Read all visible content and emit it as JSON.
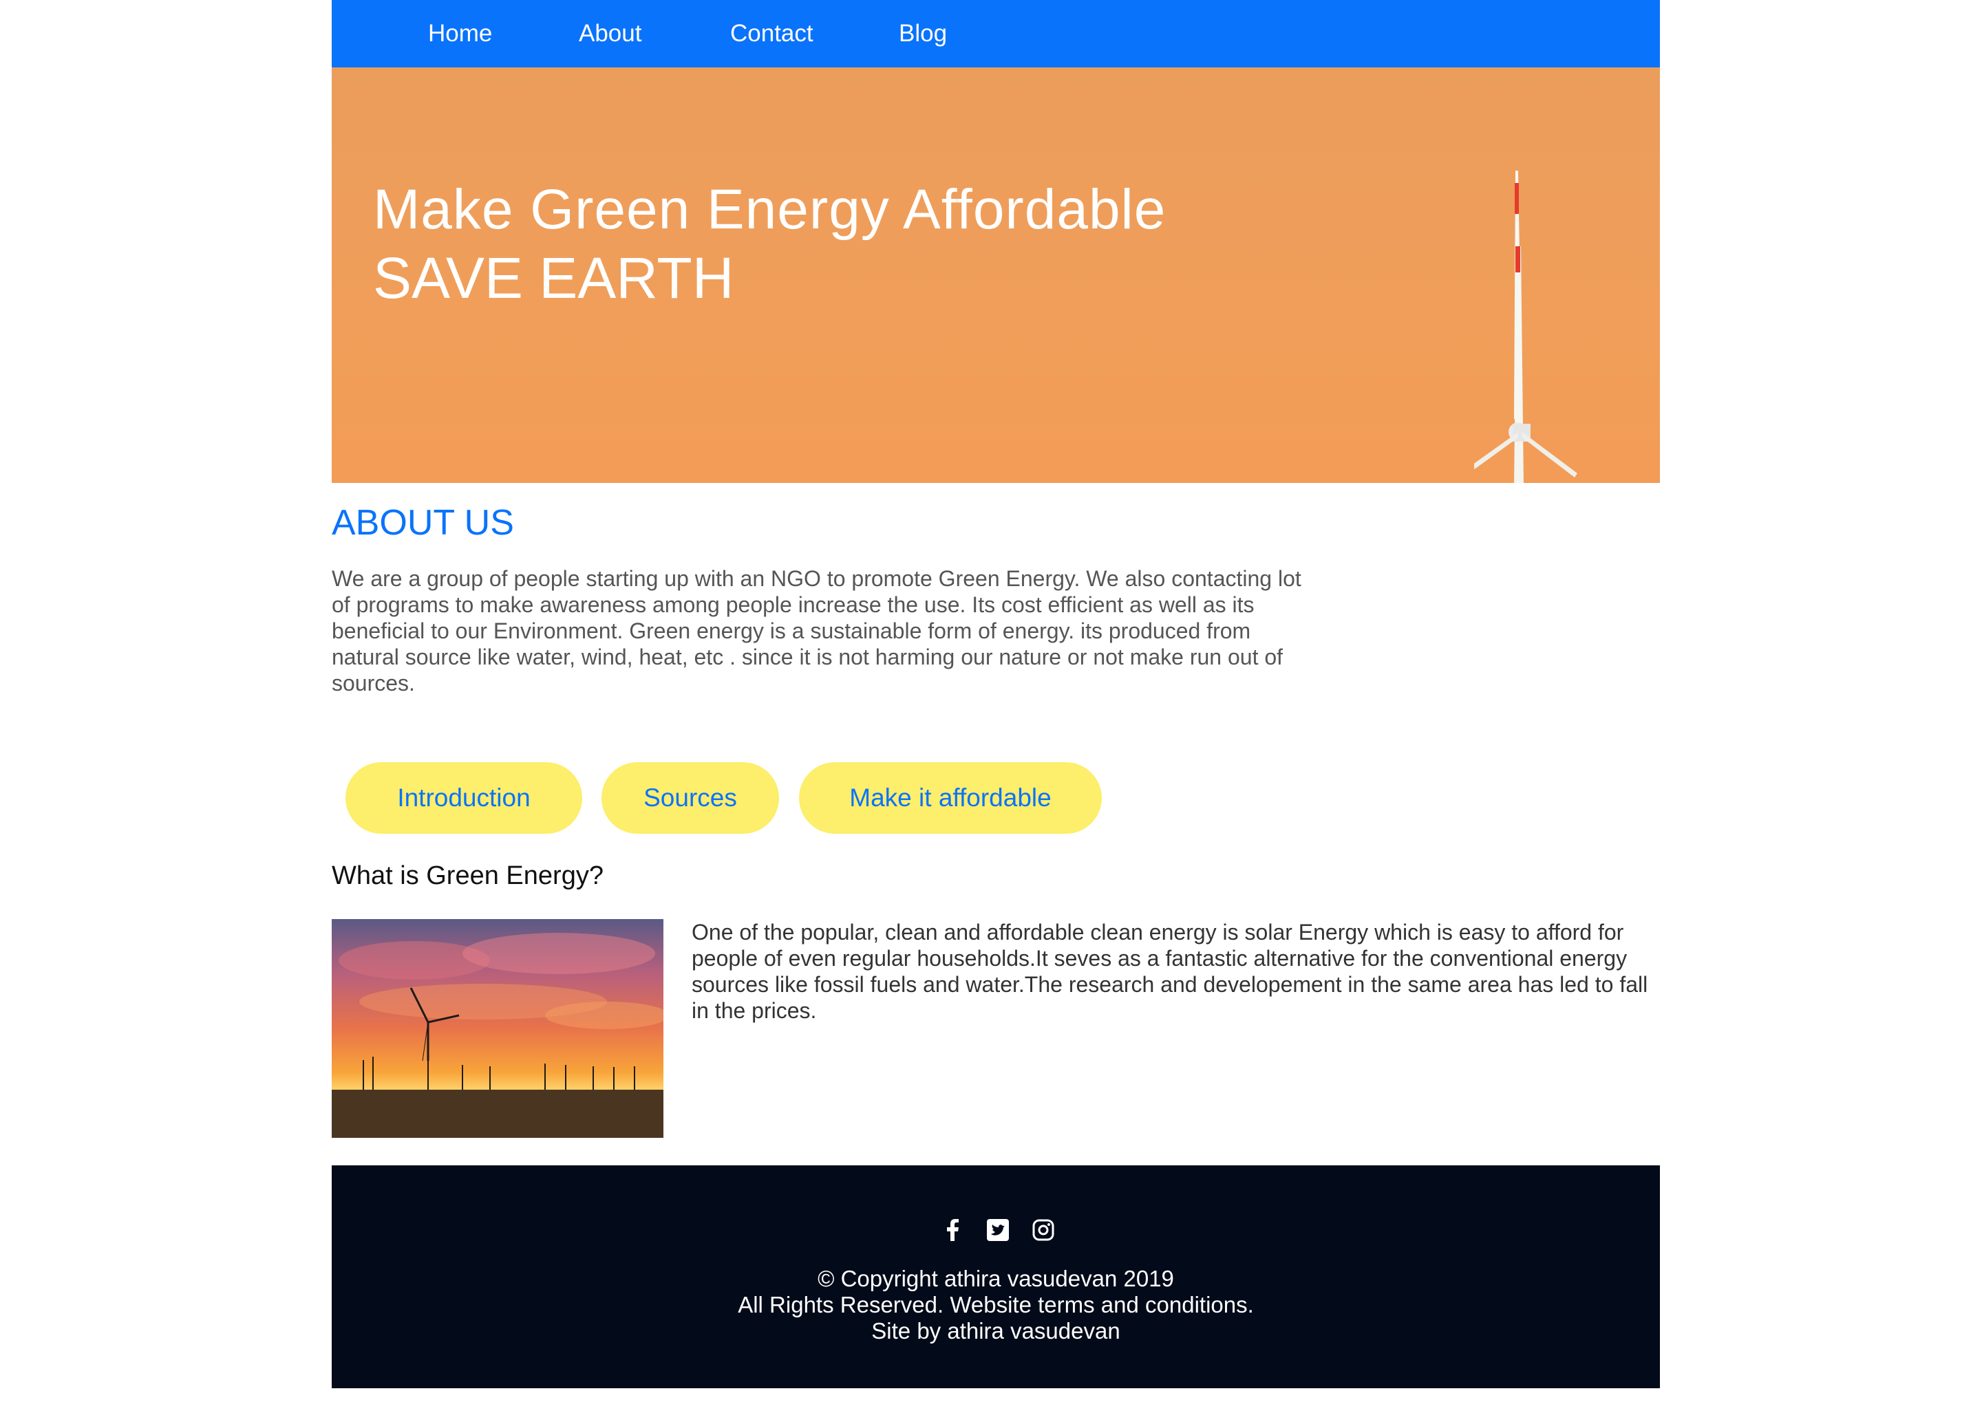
{
  "nav": {
    "items": [
      {
        "label": "Home"
      },
      {
        "label": "About"
      },
      {
        "label": "Contact"
      },
      {
        "label": "Blog"
      }
    ]
  },
  "hero": {
    "title": "Make Green Energy Affordable",
    "subtitle": "SAVE EARTH"
  },
  "about": {
    "heading": "ABOUT US",
    "text": "We are a group of people starting up with an NGO to promote Green Energy. We also contacting lot of programs to make awareness among people increase the use. Its cost efficient as well as its beneficial to our Environment. Green energy is a sustainable form of energy. its produced from natural source like water, wind, heat, etc . since it is not harming our nature or not make run out of sources."
  },
  "tabs": [
    {
      "label": "Introduction"
    },
    {
      "label": "Sources"
    },
    {
      "label": "Make it affordable"
    }
  ],
  "section": {
    "title": "What is Green Energy?",
    "text": "One of the popular, clean and affordable clean energy is solar Energy which is easy to afford for people of even regular households.It seves as a fantastic alternative for the conventional energy sources like fossil fuels and water.The research and developement in the same area has led to fall in the prices.",
    "image_icon": "wind-farm-sunset-photo"
  },
  "footer": {
    "social": [
      "facebook-icon",
      "twitter-icon",
      "instagram-icon"
    ],
    "copyright": "© Copyright athira vasudevan 2019",
    "rights": "All Rights Reserved. Website terms and conditions.",
    "credit": "Site by athira vasudevan"
  },
  "colors": {
    "nav": "#0a73fb",
    "accent": "#0a73fb",
    "button": "#fdee6b",
    "footer": "#030a19",
    "hero": "#f09e59"
  }
}
